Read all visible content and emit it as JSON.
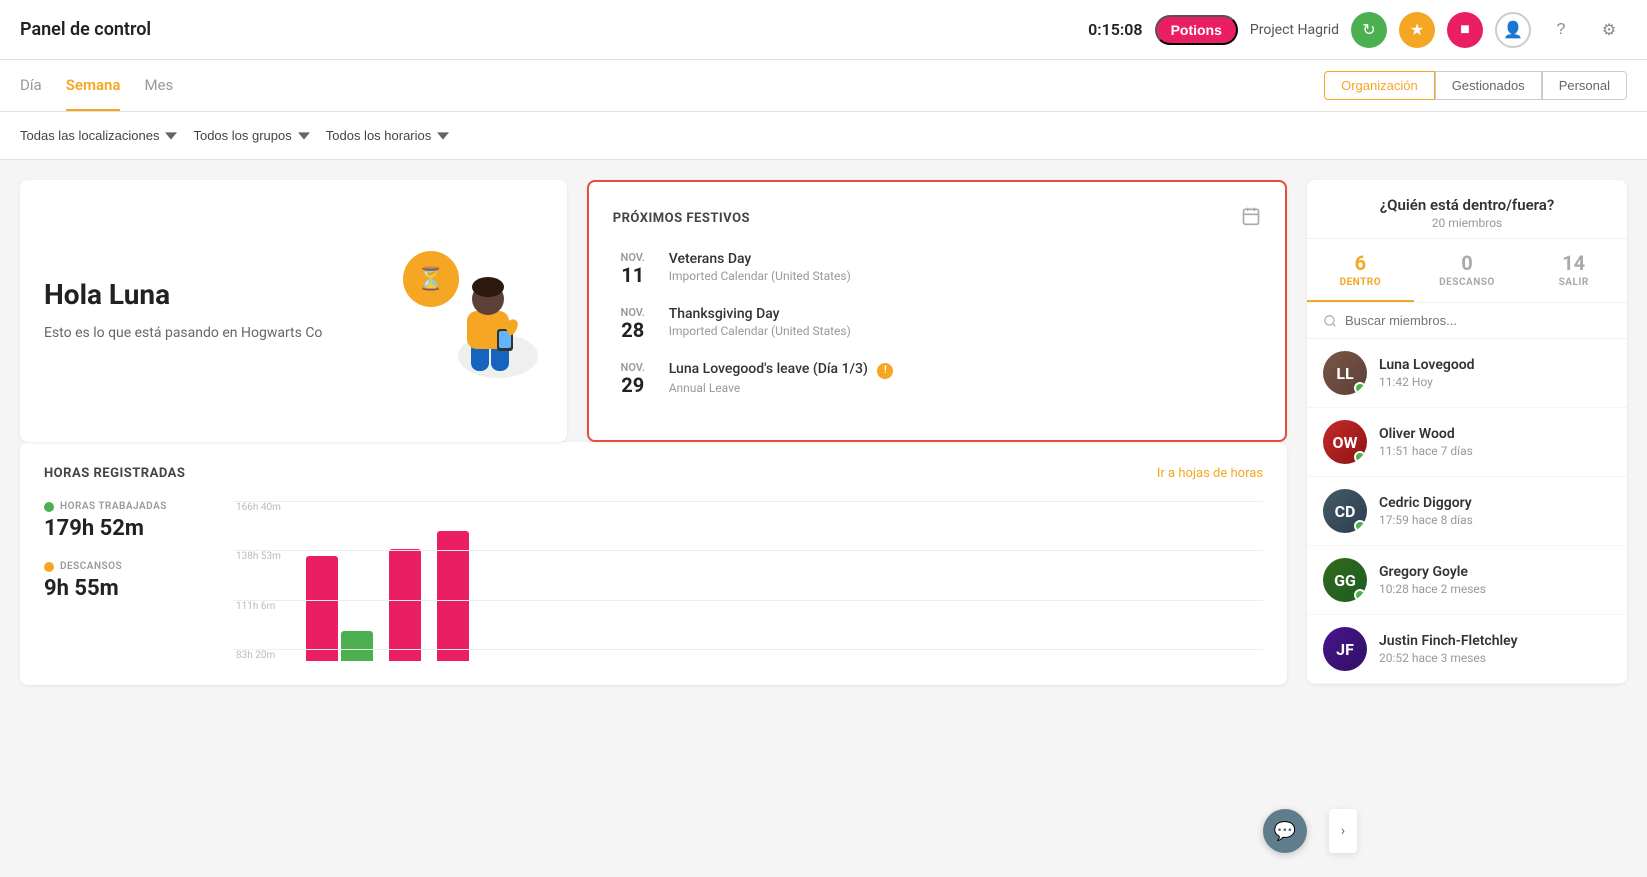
{
  "header": {
    "title": "Panel de control",
    "timer": "0:15:08",
    "potions_label": "Potions",
    "project_label": "Project Hagrid",
    "icons": {
      "sync": "↻",
      "star": "★",
      "stop": "■",
      "user": "👤",
      "help": "?",
      "settings": "⚙"
    }
  },
  "tabs": {
    "items": [
      {
        "id": "dia",
        "label": "Día",
        "active": false
      },
      {
        "id": "semana",
        "label": "Semana",
        "active": true
      },
      {
        "id": "mes",
        "label": "Mes",
        "active": false
      }
    ],
    "right_buttons": [
      {
        "id": "organizacion",
        "label": "Organización",
        "active": true
      },
      {
        "id": "gestionados",
        "label": "Gestionados",
        "active": false
      },
      {
        "id": "personal",
        "label": "Personal",
        "active": false
      }
    ]
  },
  "filters": {
    "locations": "Todas las localizaciones",
    "groups": "Todos los grupos",
    "schedules": "Todos los horarios"
  },
  "welcome": {
    "greeting": "Hola Luna",
    "description": "Esto es lo que está pasando en Hogwarts Co"
  },
  "holidays": {
    "title": "PRÓXIMOS FESTIVOS",
    "items": [
      {
        "month": "NOV.",
        "day": "11",
        "name": "Veterans Day",
        "sub": "Imported Calendar (United States)"
      },
      {
        "month": "NOV.",
        "day": "28",
        "name": "Thanksgiving Day",
        "sub": "Imported Calendar (United States)"
      },
      {
        "month": "NOV.",
        "day": "29",
        "name": "Luna Lovegood's leave (Día 1/3)",
        "sub": "Annual Leave",
        "has_tag": true
      }
    ]
  },
  "hours": {
    "title": "HORAS REGISTRADAS",
    "link_label": "Ir a hojas de horas",
    "worked_label": "HORAS TRABAJADAS",
    "worked_value": "179h 52m",
    "breaks_label": "DESCANSOS",
    "breaks_value": "9h 55m",
    "chart": {
      "y_labels": [
        "166h 40m",
        "138h 53m",
        "111h 6m",
        "83h 20m"
      ],
      "bars": [
        {
          "pink_pct": 70,
          "green_pct": 20
        },
        {
          "pink_pct": 75,
          "green_pct": 0
        },
        {
          "pink_pct": 85,
          "green_pct": 0
        }
      ]
    }
  },
  "who": {
    "title": "¿Quién está dentro/fuera?",
    "subtitle": "20 miembros",
    "stats": [
      {
        "id": "dentro",
        "num": "6",
        "label": "DENTRO",
        "active": true
      },
      {
        "id": "descanso",
        "num": "0",
        "label": "DESCANSO",
        "active": false
      },
      {
        "id": "salir",
        "num": "14",
        "label": "SALIR",
        "active": false
      }
    ],
    "search_placeholder": "Buscar miembros...",
    "members": [
      {
        "name": "Luna Lovegood",
        "time": "11:42 Hoy",
        "color": "av-luna",
        "initials": "LL",
        "online": true
      },
      {
        "name": "Oliver Wood",
        "time": "11:51 hace 7 días",
        "color": "av-oliver",
        "initials": "OW",
        "online": true
      },
      {
        "name": "Cedric Diggory",
        "time": "17:59 hace 8 días",
        "color": "av-cedric",
        "initials": "CD",
        "online": true
      },
      {
        "name": "Gregory Goyle",
        "time": "10:28 hace 2 meses",
        "color": "av-gregory",
        "initials": "GG",
        "online": true
      },
      {
        "name": "Justin Finch-Fletchley",
        "time": "20:52 hace 3 meses",
        "color": "av-justin",
        "initials": "JF",
        "online": false
      }
    ]
  }
}
